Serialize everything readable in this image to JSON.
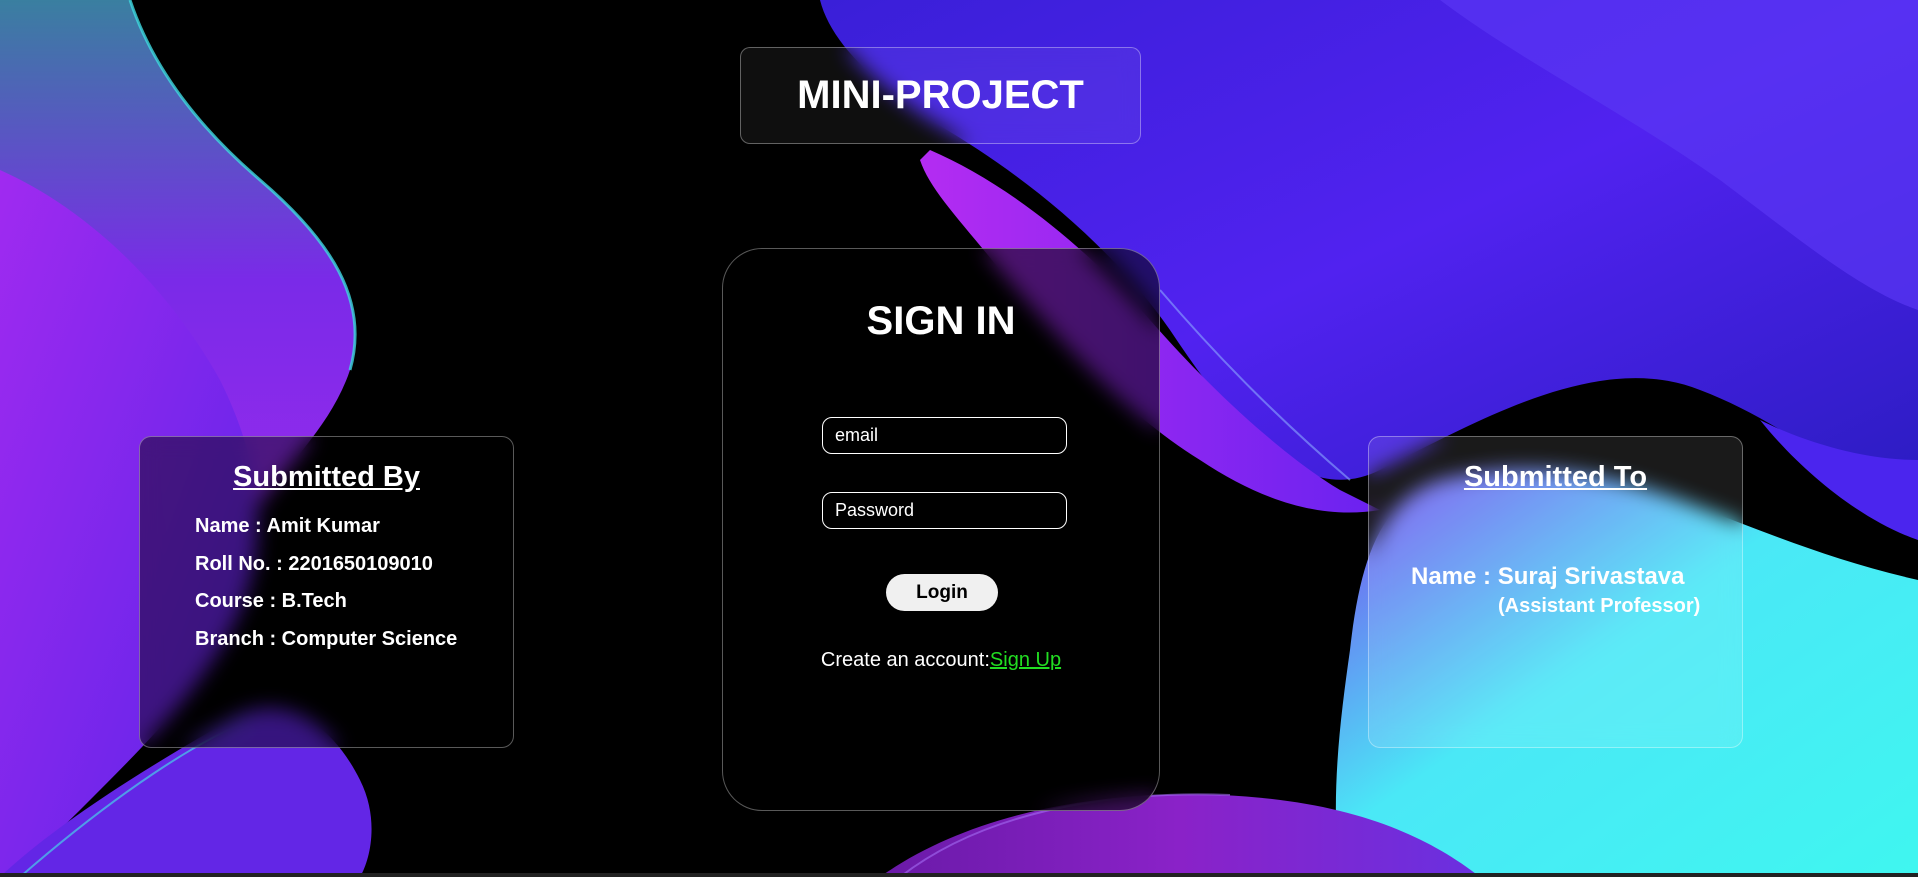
{
  "header": {
    "title": "MINI-PROJECT"
  },
  "signin": {
    "heading": "SIGN IN",
    "email_placeholder": "email",
    "password_placeholder": "Password",
    "login_label": "Login",
    "create_text": "Create an account:",
    "signup_link": "Sign Up"
  },
  "submitted_by": {
    "heading": "Submitted By",
    "lines": [
      "Name : Amit Kumar",
      "Roll No. : 2201650109010",
      "Course : B.Tech",
      "Branch : Computer Science"
    ]
  },
  "submitted_to": {
    "heading": "Submitted To",
    "name": "Name : Suraj Srivastava",
    "role": "(Assistant Professor)"
  },
  "colors": {
    "background": "#000000",
    "purple": "#9a2cf0",
    "blue_violet": "#4a1fe0",
    "cyan": "#3ff2f4",
    "link": "#22dd22"
  }
}
